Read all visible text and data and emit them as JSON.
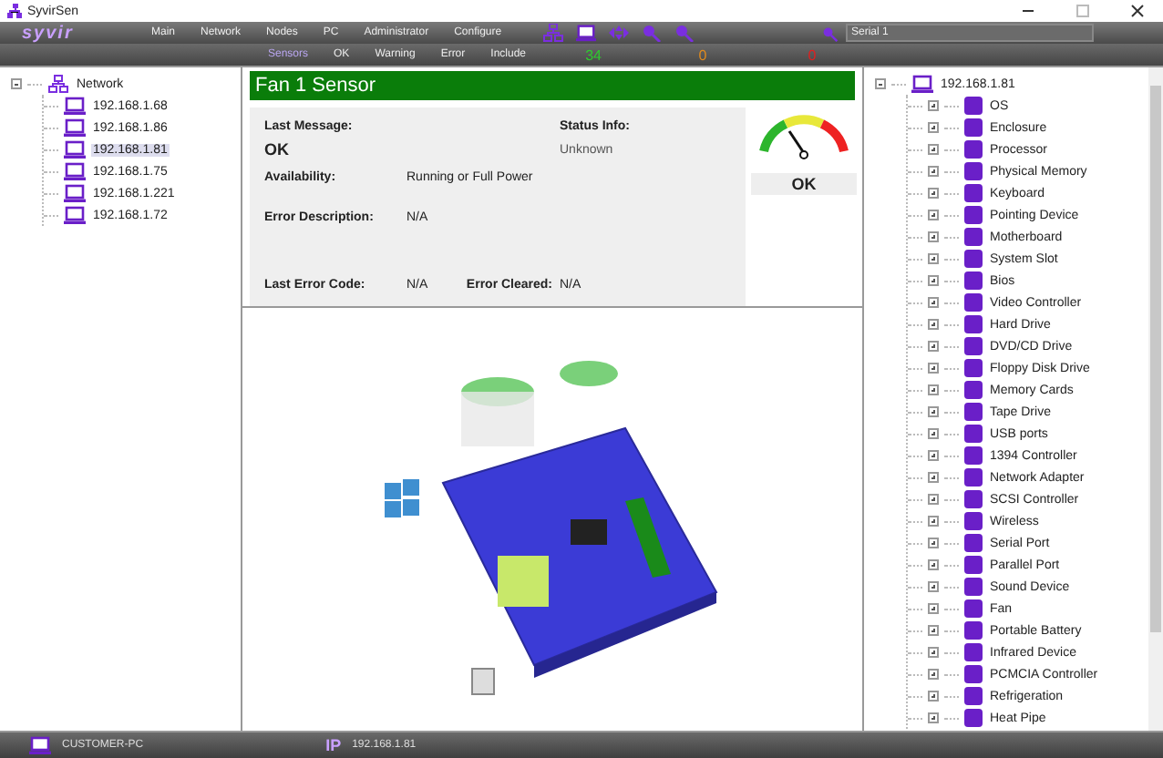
{
  "window": {
    "title": "SyvirSen"
  },
  "toolbar": {
    "logo": "syvir",
    "menu": [
      "Main",
      "Network",
      "Nodes",
      "PC",
      "Administrator",
      "Configure"
    ],
    "serial_field": {
      "value": "Serial 1"
    }
  },
  "filter_bar": {
    "tabs": [
      {
        "label": "Sensors",
        "selected": true
      },
      {
        "label": "OK",
        "selected": false
      },
      {
        "label": "Warning",
        "selected": false
      },
      {
        "label": "Error",
        "selected": false
      },
      {
        "label": "Include",
        "selected": false
      }
    ],
    "counts": [
      {
        "value": "34",
        "color": "#2ecc2e"
      },
      {
        "value": "0",
        "color": "#e08a1e"
      },
      {
        "value": "0",
        "color": "#e02020"
      }
    ]
  },
  "network_tree": {
    "label": "Network",
    "expanded": true,
    "children": [
      {
        "label": "192.168.1.68",
        "selected": false
      },
      {
        "label": "192.168.1.86",
        "selected": false
      },
      {
        "label": "192.168.1.81",
        "selected": true
      },
      {
        "label": "192.168.1.75",
        "selected": false
      },
      {
        "label": "192.168.1.221",
        "selected": false
      },
      {
        "label": "192.168.1.72",
        "selected": false
      }
    ]
  },
  "sensor": {
    "title": "Fan 1 Sensor",
    "last_message_label": "Last Message:",
    "last_message": "OK",
    "status_info_label": "Status Info:",
    "status_info": "Unknown",
    "availability_label": "Availability:",
    "availability": "Running or Full Power",
    "error_description_label": "Error Description:",
    "error_description": "N/A",
    "last_error_code_label": "Last Error Code:",
    "last_error_code": "N/A",
    "error_cleared_label": "Error Cleared:",
    "error_cleared": "N/A",
    "gauge_label": "OK"
  },
  "device_tree": {
    "label": "192.168.1.81",
    "expanded": true,
    "children": [
      {
        "label": "OS",
        "expanded": false
      },
      {
        "label": "Enclosure",
        "expanded": false
      },
      {
        "label": "Processor",
        "expanded": false
      },
      {
        "label": "Physical Memory",
        "expanded": false
      },
      {
        "label": "Keyboard",
        "expanded": false
      },
      {
        "label": "Pointing Device",
        "expanded": false
      },
      {
        "label": "Motherboard",
        "expanded": false
      },
      {
        "label": "System Slot",
        "expanded": false
      },
      {
        "label": "Bios",
        "expanded": false
      },
      {
        "label": "Video Controller",
        "expanded": false
      },
      {
        "label": "Hard Drive",
        "expanded": false
      },
      {
        "label": "DVD/CD Drive",
        "expanded": false
      },
      {
        "label": "Floppy Disk Drive",
        "expanded": false
      },
      {
        "label": "Memory Cards",
        "expanded": false
      },
      {
        "label": "Tape Drive",
        "expanded": false
      },
      {
        "label": "USB ports",
        "expanded": false
      },
      {
        "label": "1394 Controller",
        "expanded": false
      },
      {
        "label": "Network Adapter",
        "expanded": false
      },
      {
        "label": "SCSI Controller",
        "expanded": false
      },
      {
        "label": "Wireless",
        "expanded": false
      },
      {
        "label": "Serial Port",
        "expanded": false
      },
      {
        "label": "Parallel Port",
        "expanded": false
      },
      {
        "label": "Sound Device",
        "expanded": false
      },
      {
        "label": "Fan",
        "expanded": false
      },
      {
        "label": "Portable Battery",
        "expanded": false
      },
      {
        "label": "Infrared Device",
        "expanded": false
      },
      {
        "label": "PCMCIA Controller",
        "expanded": false
      },
      {
        "label": "Refrigeration",
        "expanded": false
      },
      {
        "label": "Heat Pipe",
        "expanded": false
      }
    ]
  },
  "status_bar": {
    "computer": "CUSTOMER-PC",
    "ip_label": "IP",
    "ip": "192.168.1.81"
  }
}
